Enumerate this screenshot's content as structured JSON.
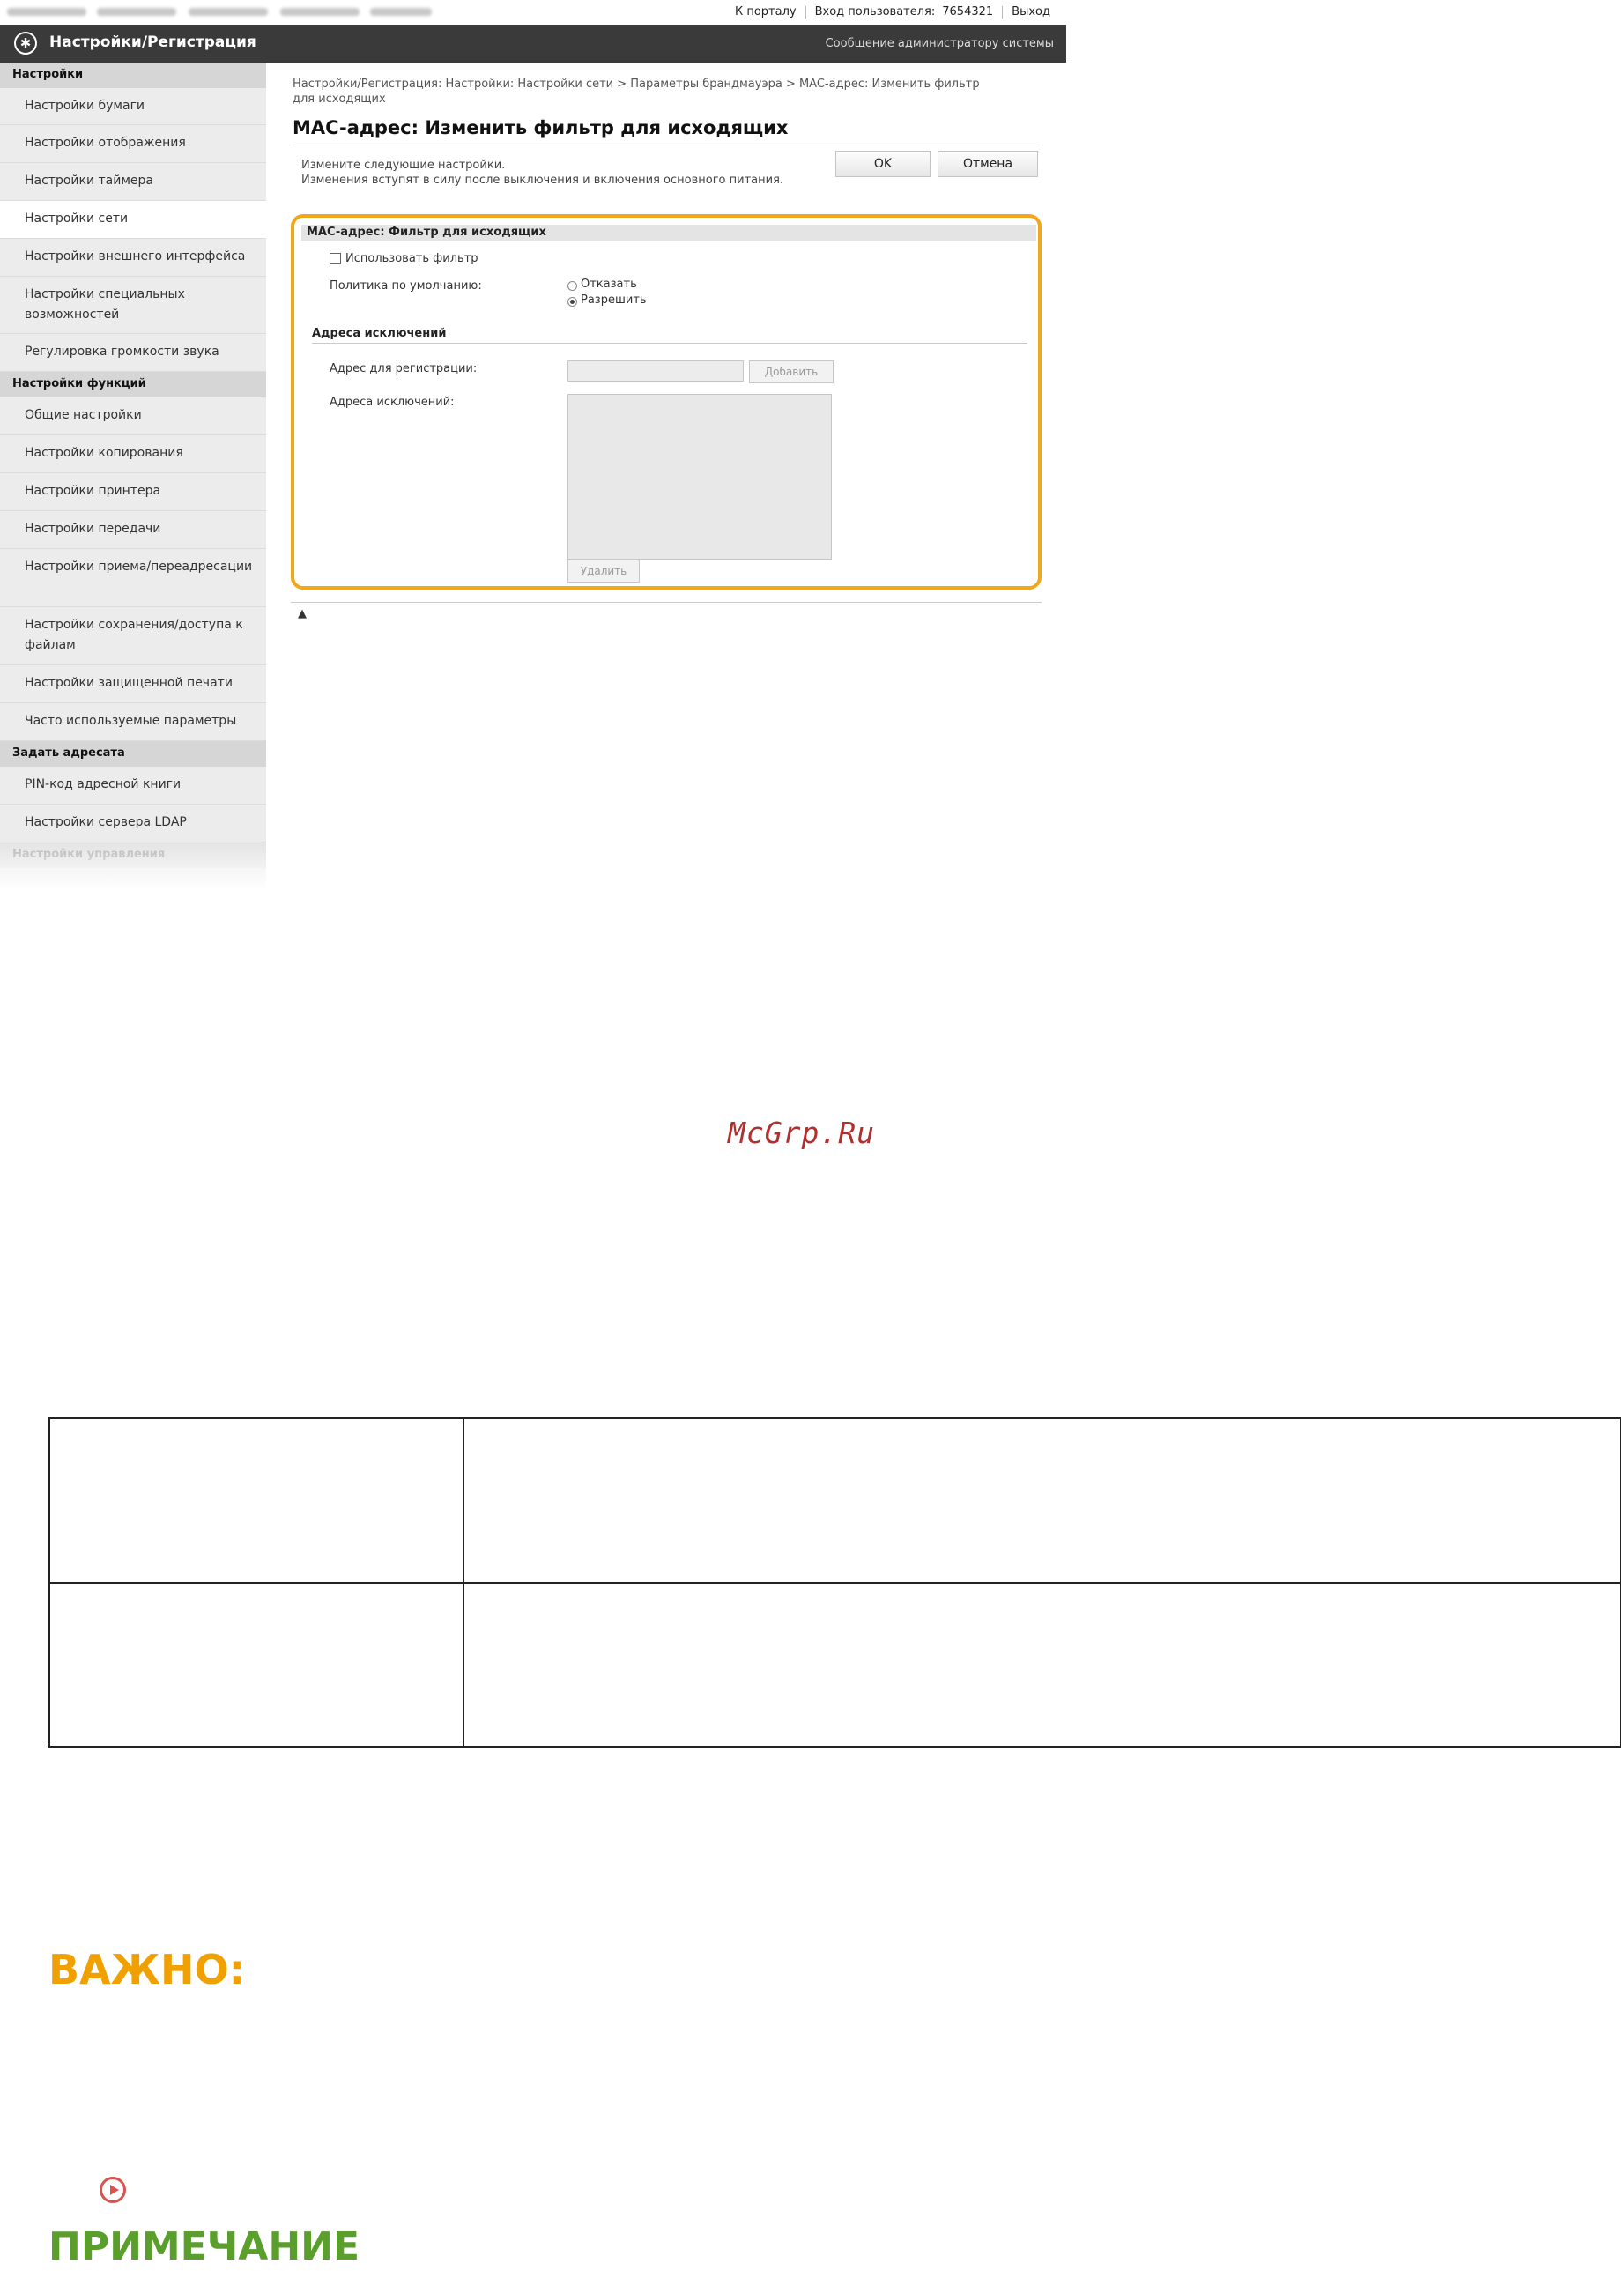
{
  "topbar": {
    "portal_link": "К порталу",
    "login_label": "Вход пользователя:",
    "user_id": "7654321",
    "logout_link": "Выход"
  },
  "header": {
    "app_title": "Настройки/Регистрация",
    "admin_message": "Сообщение администратору системы"
  },
  "sidebar": {
    "group_settings": "Настройки",
    "settings_items": [
      "Настройки бумаги",
      "Настройки отображения",
      "Настройки таймера",
      "Настройки сети",
      "Настройки внешнего интерфейса",
      "Настройки специальных возможностей",
      "Регулировка громкости звука"
    ],
    "group_functions": "Настройки функций",
    "function_items": [
      "Общие настройки",
      "Настройки копирования",
      "Настройки принтера",
      "Настройки передачи",
      "Настройки приема/переадресации",
      "Настройки сохранения/доступа к файлам",
      "Настройки защищенной печати",
      "Часто используемые параметры"
    ],
    "group_address": "Задать адресата",
    "address_items": [
      "PIN-код адресной книги",
      "Настройки сервера LDAP"
    ],
    "group_management": "Настройки управления"
  },
  "content": {
    "breadcrumb": "Настройки/Регистрация: Настройки: Настройки сети > Параметры брандмауэра > MAC-адрес: Изменить фильтр для исходящих",
    "title": "MAC-адрес: Изменить фильтр для исходящих",
    "intro_line1": "Измените следующие настройки.",
    "intro_line2": "Изменения вступят в силу после выключения и включения основного питания.",
    "ok_label": "OK",
    "cancel_label": "Отмена",
    "panel_title": "MAC-адрес: Фильтр для исходящих",
    "use_filter_label": "Использовать фильтр",
    "default_policy_label": "Политика по умолчанию:",
    "policy_reject": "Отказать",
    "policy_allow": "Разрешить",
    "exception_heading": "Адреса исключений",
    "register_address_label": "Адрес для регистрации:",
    "add_button": "Добавить",
    "exception_list_label": "Адреса исключений:",
    "delete_button": "Удалить",
    "top_icon": "▲"
  },
  "document": {
    "watermark": "McGrp.Ru",
    "important_heading": "ВАЖНО:",
    "note_heading": "ПРИМЕЧАНИЕ"
  }
}
